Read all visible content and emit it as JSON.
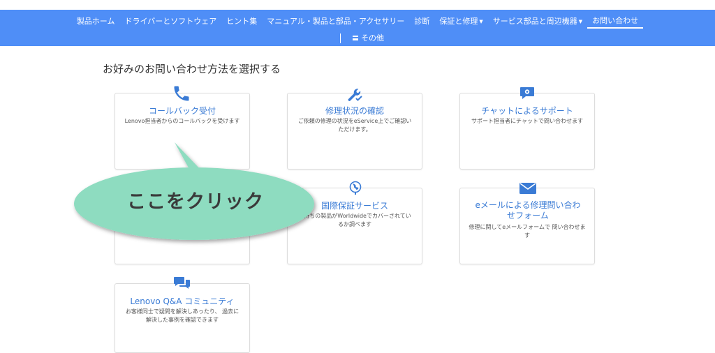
{
  "nav": {
    "items": [
      {
        "label": "製品ホーム",
        "caret": false,
        "active": false
      },
      {
        "label": "ドライバーとソフトウェア",
        "caret": false,
        "active": false
      },
      {
        "label": "ヒント集",
        "caret": false,
        "active": false
      },
      {
        "label": "マニュアル・製品と部品・アクセサリー",
        "caret": false,
        "active": false
      },
      {
        "label": "診断",
        "caret": false,
        "active": false
      },
      {
        "label": "保証と修理",
        "caret": true,
        "active": false
      },
      {
        "label": "サービス部品と周辺機器",
        "caret": true,
        "active": false
      },
      {
        "label": "お問い合わせ",
        "caret": false,
        "active": true
      }
    ],
    "other_label": "その他"
  },
  "main": {
    "heading": "お好みのお問い合わせ方法を選択する",
    "cards": [
      {
        "title": "コールバック受付",
        "desc": "Lenovo担当者からのコールバックを受けます",
        "icon": "phone-icon"
      },
      {
        "title": "修理状況の確認",
        "desc": "ご依頼の修理の状況をeService上でご確認いただけます。",
        "icon": "wrench-check-icon"
      },
      {
        "title": "チャットによるサポート",
        "desc": "サポート担当者にチャットで問い合わせます",
        "icon": "chat-gear-icon"
      },
      {
        "title": "",
        "desc": "",
        "icon": ""
      },
      {
        "title": "国際保証サービス",
        "desc": "お持ちの製品がWorldwideでカバーされているか調べます",
        "icon": "globe-icon"
      },
      {
        "title": "eメールによる修理問い合わせフォーム",
        "desc": "修理に関してeメールフォームで 問い合わせます",
        "icon": "envelope-icon"
      },
      {
        "title": "Lenovo Q&A コミュニティ",
        "desc": "お客様同士で疑問を解決しあったり、 過去に解決した事例を確認できます",
        "icon": "chat-bubbles-icon"
      }
    ]
  },
  "callout": {
    "text": "ここをクリック"
  },
  "colors": {
    "nav_bg": "#4f8ef7",
    "accent": "#3a7bd5",
    "bubble": "#8edcc0"
  }
}
